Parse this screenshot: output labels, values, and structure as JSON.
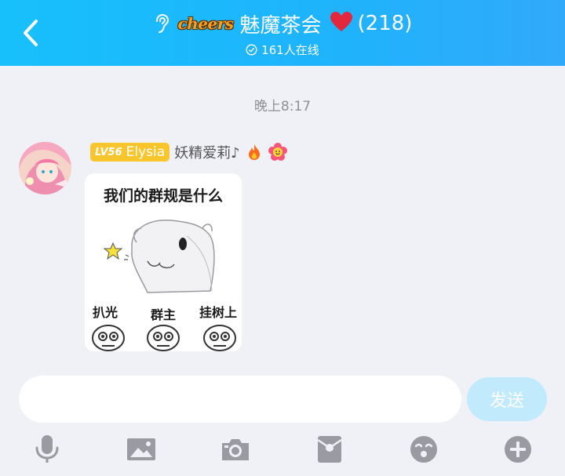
{
  "header": {
    "back_icon": "chevron-left-icon",
    "ear_icon": "ear-icon",
    "cheers_text": "cheers",
    "group_name": "魅魔茶会",
    "heart": "❤️",
    "member_count": "(218)",
    "online_text": "161人在线",
    "background": "#1fb3fc"
  },
  "chat": {
    "timestamp": "晚上8:17",
    "message": {
      "level_prefix": "LV56",
      "level_name": "Elysia",
      "nickname": "妖精爱莉♪",
      "badge_icons": [
        "fire-emoji",
        "flower-emoji"
      ],
      "sticker": {
        "title": "我们的群规是什么",
        "labels": [
          "扒光",
          "群主",
          "挂树上"
        ]
      }
    }
  },
  "input": {
    "placeholder": "",
    "send_label": "发送",
    "send_color": "#c2eafd"
  },
  "toolbar": {
    "icons": [
      "microphone-icon",
      "image-icon",
      "camera-icon",
      "red-packet-icon",
      "emoji-icon",
      "plus-icon"
    ]
  }
}
